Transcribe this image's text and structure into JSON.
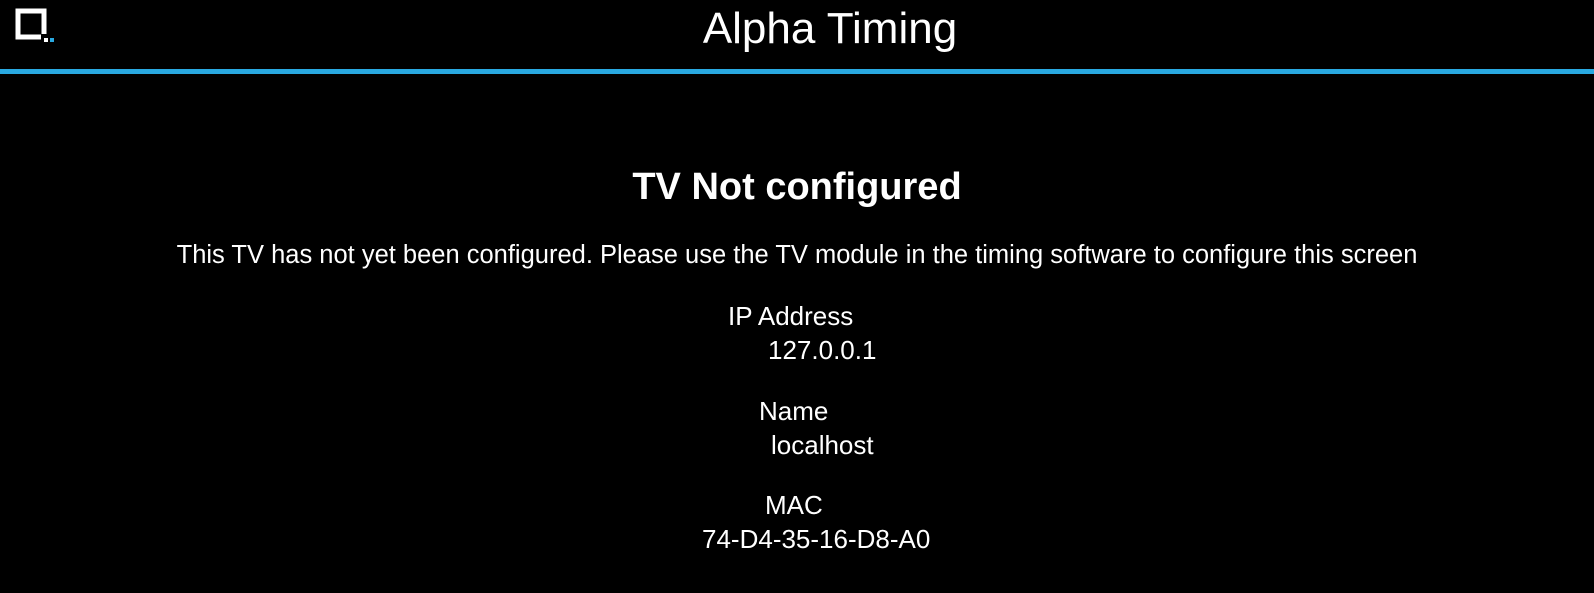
{
  "header": {
    "title": "Alpha Timing",
    "logo_icon": "crop-square-icon",
    "accent_color": "#29a9e1"
  },
  "main": {
    "heading": "TV Not configured",
    "message": "This TV has not yet been configured. Please use the TV module in the timing software to configure this screen",
    "info": {
      "ip_label": "IP Address",
      "ip_value": "127.0.0.1",
      "name_label": "Name",
      "name_value": "localhost",
      "mac_label": "MAC",
      "mac_value": "74-D4-35-16-D8-A0"
    }
  }
}
